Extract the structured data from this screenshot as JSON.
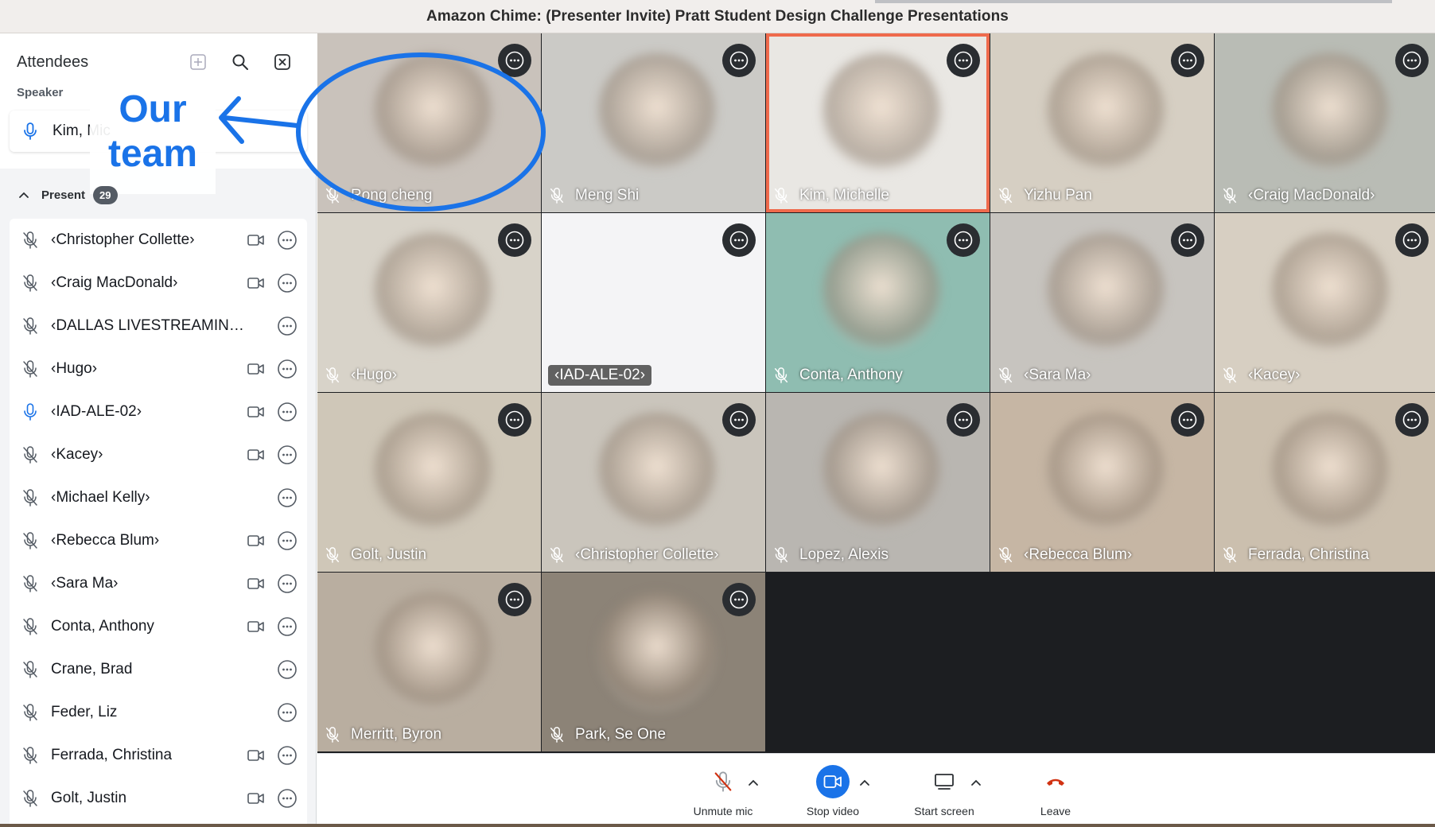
{
  "window": {
    "title": "Amazon Chime: (Presenter Invite) Pratt Student Design Challenge Presentations"
  },
  "sidebar": {
    "title": "Attendees",
    "speaker_heading": "Speaker",
    "speaker_name": "Kim, Mic",
    "present_label": "Present",
    "present_count": "29",
    "attendees": [
      {
        "name": "‹Christopher Collette›",
        "mic": "muted",
        "camera": true
      },
      {
        "name": "‹Craig MacDonald›",
        "mic": "muted",
        "camera": true
      },
      {
        "name": "‹DALLAS LIVESTREAMIN…",
        "mic": "muted",
        "camera": false
      },
      {
        "name": "‹Hugo›",
        "mic": "muted",
        "camera": true
      },
      {
        "name": "‹IAD-ALE-02›",
        "mic": "on",
        "camera": true
      },
      {
        "name": "‹Kacey›",
        "mic": "muted",
        "camera": true
      },
      {
        "name": "‹Michael Kelly›",
        "mic": "muted",
        "camera": false
      },
      {
        "name": "‹Rebecca Blum›",
        "mic": "muted",
        "camera": true
      },
      {
        "name": "‹Sara Ma›",
        "mic": "muted",
        "camera": true
      },
      {
        "name": "Conta, Anthony",
        "mic": "muted",
        "camera": true
      },
      {
        "name": "Crane, Brad",
        "mic": "muted",
        "camera": false
      },
      {
        "name": "Feder, Liz",
        "mic": "muted",
        "camera": false
      },
      {
        "name": "Ferrada, Christina",
        "mic": "muted",
        "camera": true
      },
      {
        "name": "Golt, Justin",
        "mic": "muted",
        "camera": true
      }
    ]
  },
  "annotation": {
    "line1": "Our",
    "line2": "team",
    "color": "#1a73e8"
  },
  "tiles": [
    {
      "name": "Rong cheng",
      "bg": "#c9c2bb"
    },
    {
      "name": "Meng Shi",
      "bg": "#cbcac6"
    },
    {
      "name": "Kim, Michelle",
      "bg": "#e9e7e3",
      "active": true
    },
    {
      "name": "Yizhu Pan",
      "bg": "#d6cfc3"
    },
    {
      "name": "‹Craig MacDonald›",
      "bg": "#b9bcb5"
    },
    {
      "name": "‹Hugo›",
      "bg": "#d8d3c9"
    },
    {
      "name": "‹IAD-ALE-02›",
      "bg": "#f4f4f6"
    },
    {
      "name": "Conta, Anthony",
      "bg": "#8fbdb1"
    },
    {
      "name": "‹Sara Ma›",
      "bg": "#c7c4bf"
    },
    {
      "name": "‹Kacey›",
      "bg": "#d7cfc2"
    },
    {
      "name": "Golt, Justin",
      "bg": "#cfc7b8"
    },
    {
      "name": "‹Christopher Collette›",
      "bg": "#cac5bc"
    },
    {
      "name": "Lopez, Alexis",
      "bg": "#b9b6b1"
    },
    {
      "name": "‹Rebecca Blum›",
      "bg": "#c6b6a4"
    },
    {
      "name": "Ferrada, Christina",
      "bg": "#cbbfae"
    },
    {
      "name": "Merritt, Byron",
      "bg": "#b9aea0"
    },
    {
      "name": "Park, Se One",
      "bg": "#8c8377"
    }
  ],
  "controls": {
    "unmute_label": "Unmute mic",
    "video_label": "Stop video",
    "screen_label": "Start screen",
    "leave_label": "Leave"
  }
}
